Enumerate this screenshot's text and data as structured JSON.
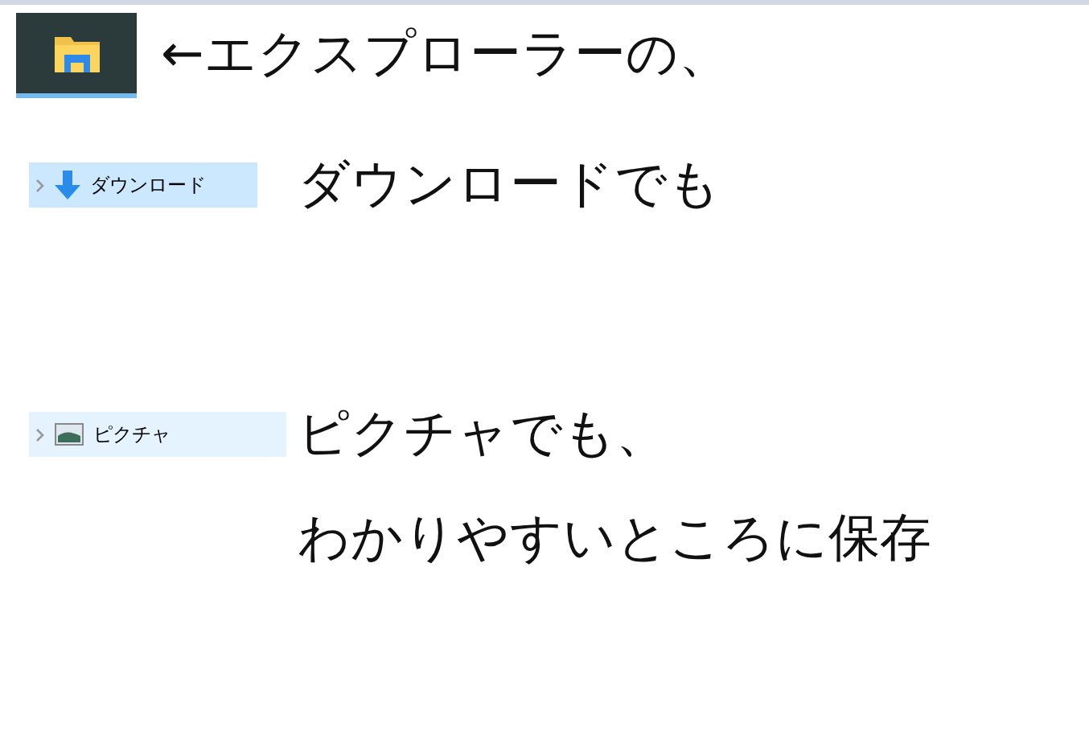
{
  "taskbar_icon": {
    "caption": "←エクスプローラーの、"
  },
  "nav_items": [
    {
      "label": "ダウンロード",
      "kind": "download",
      "selected": true,
      "caption": "ダウンロードでも"
    },
    {
      "label": "ピクチャ",
      "kind": "pictures",
      "selected": false,
      "caption": "ピクチャでも、"
    }
  ],
  "closing_caption": "わかりやすいところに保存"
}
